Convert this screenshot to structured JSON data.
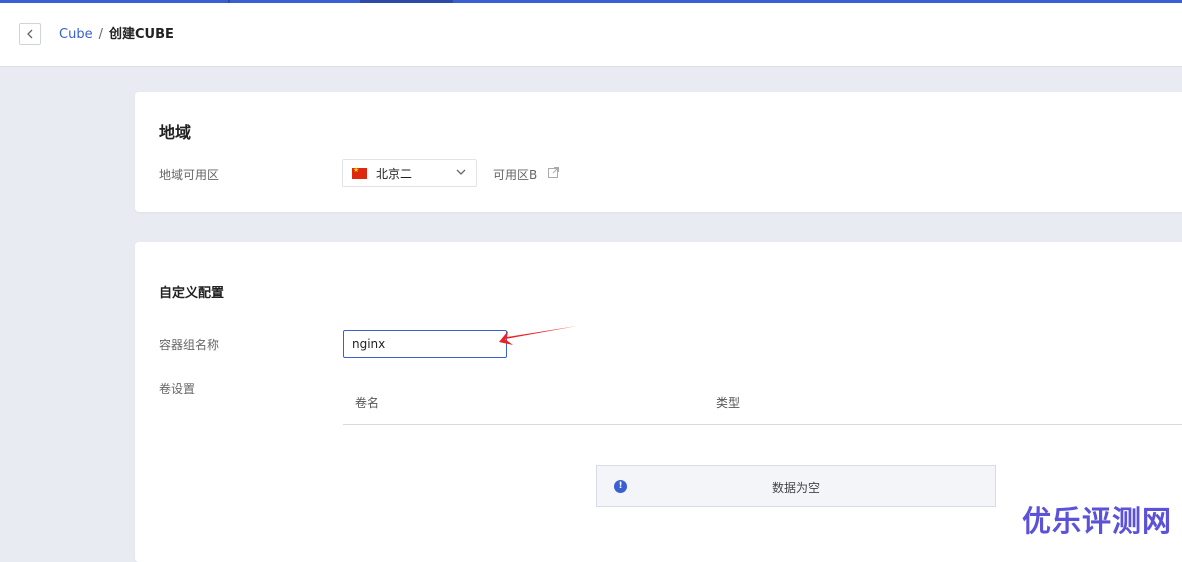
{
  "breadcrumb": {
    "parent": "Cube",
    "separator": "/",
    "current": "创建CUBE"
  },
  "region_section": {
    "title": "地域",
    "field_label": "地域可用区",
    "region_value": "北京二",
    "zone_text": "可用区B"
  },
  "custom_section": {
    "title": "自定义配置",
    "name_label": "容器组名称",
    "name_value": "nginx",
    "volume_label": "卷设置",
    "volume_columns": [
      "卷名",
      "类型"
    ],
    "empty_text": "数据为空"
  },
  "watermark": "优乐评测网",
  "colors": {
    "accent": "#3a5fd0",
    "background": "#e9ebf3",
    "annotation_arrow": "#e8232a",
    "watermark": "#5b52d8"
  },
  "icons": [
    "chevron-left-icon",
    "china-flag-icon",
    "chevron-down-icon",
    "external-link-icon",
    "info-icon",
    "red-arrow-annotation"
  ]
}
